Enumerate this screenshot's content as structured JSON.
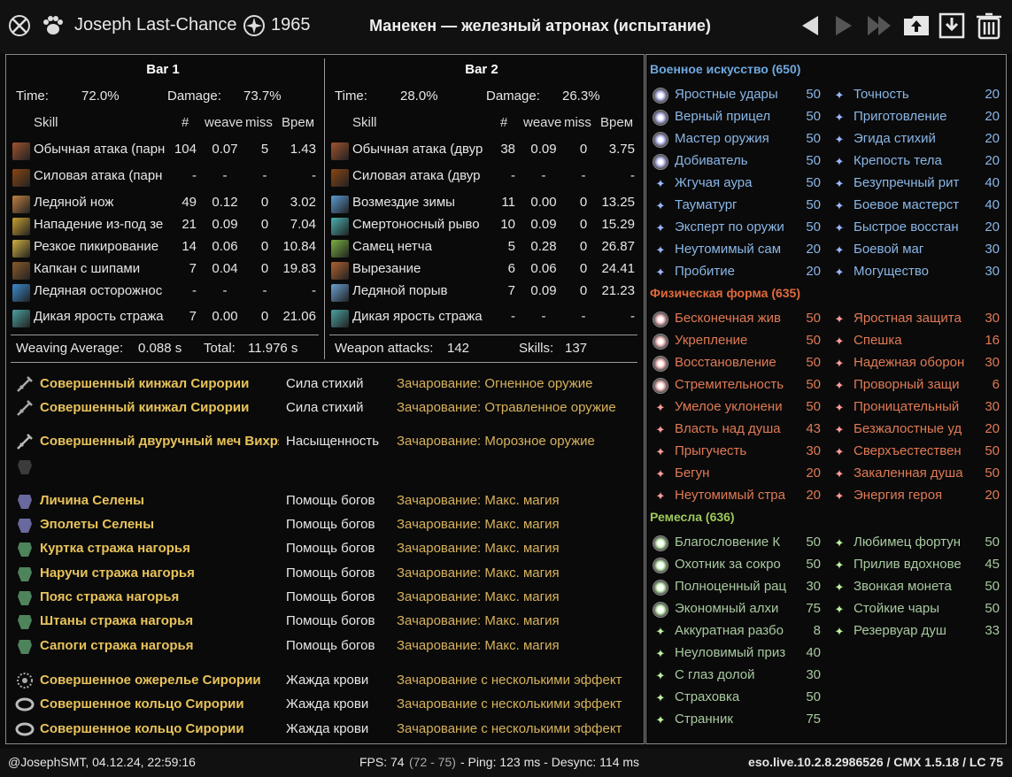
{
  "header": {
    "player": "Joseph Last-Chance",
    "cp": "1965",
    "title": "Манекен — железный атронах (испытание)"
  },
  "bar1": {
    "title": "Bar 1",
    "time_label": "Time:",
    "time": "72.0%",
    "damage_label": "Damage:",
    "damage": "73.7%",
    "cols": {
      "skill": "Skill",
      "count": "#",
      "weave": "weave",
      "miss": "miss",
      "time": "Врем"
    },
    "rows": [
      {
        "name": "Обычная атака (парн",
        "count": "104",
        "weave": "0.07",
        "miss": "5",
        "time": "1.43"
      },
      {
        "name": "Силовая атака (парн",
        "count": "-",
        "weave": "-",
        "miss": "-",
        "time": "-"
      },
      {
        "name": "Ледяной нож",
        "count": "49",
        "weave": "0.12",
        "miss": "0",
        "time": "3.02"
      },
      {
        "name": "Нападение из-под зе",
        "count": "21",
        "weave": "0.09",
        "miss": "0",
        "time": "7.04"
      },
      {
        "name": "Резкое пикирование",
        "count": "14",
        "weave": "0.06",
        "miss": "0",
        "time": "10.84"
      },
      {
        "name": "Капкан с шипами",
        "count": "7",
        "weave": "0.04",
        "miss": "0",
        "time": "19.83"
      },
      {
        "name": "Ледяная осторожнос",
        "count": "-",
        "weave": "-",
        "miss": "-",
        "time": "-"
      },
      {
        "name": "Дикая ярость стража",
        "count": "7",
        "weave": "0.00",
        "miss": "0",
        "time": "21.06"
      }
    ],
    "footer_label1": "Weaving Average:",
    "footer_val1": "0.088 s",
    "footer_label2": "Total:",
    "footer_val2": "11.976 s"
  },
  "bar2": {
    "title": "Bar 2",
    "time_label": "Time:",
    "time": "28.0%",
    "damage_label": "Damage:",
    "damage": "26.3%",
    "cols": {
      "skill": "Skill",
      "count": "#",
      "weave": "weave",
      "miss": "miss",
      "time": "Врем"
    },
    "rows": [
      {
        "name": "Обычная атака (двур",
        "count": "38",
        "weave": "0.09",
        "miss": "0",
        "time": "3.75"
      },
      {
        "name": "Силовая атака (двур",
        "count": "-",
        "weave": "-",
        "miss": "-",
        "time": "-"
      },
      {
        "name": "Возмездие зимы",
        "count": "11",
        "weave": "0.00",
        "miss": "0",
        "time": "13.25"
      },
      {
        "name": "Смертоносный рыво",
        "count": "10",
        "weave": "0.09",
        "miss": "0",
        "time": "15.29"
      },
      {
        "name": "Самец нетча",
        "count": "5",
        "weave": "0.28",
        "miss": "0",
        "time": "26.87"
      },
      {
        "name": "Вырезание",
        "count": "6",
        "weave": "0.06",
        "miss": "0",
        "time": "24.41"
      },
      {
        "name": "Ледяной порыв",
        "count": "7",
        "weave": "0.09",
        "miss": "0",
        "time": "21.23"
      },
      {
        "name": "Дикая ярость стража",
        "count": "-",
        "weave": "-",
        "miss": "-",
        "time": "-"
      }
    ],
    "footer_label1": "Weapon attacks:",
    "footer_val1": "142",
    "footer_label2": "Skills:",
    "footer_val2": "137"
  },
  "gear": [
    {
      "name": "Совершенный кинжал Сирории",
      "trait": "Сила стихий",
      "ench": "Зачарование: Огненное оружие",
      "icon": "dagger-icon"
    },
    {
      "name": "Совершенный кинжал Сирории",
      "trait": "Сила стихий",
      "ench": "Зачарование: Отравленное оружие",
      "icon": "dagger-icon"
    },
    {
      "name": "Совершенный двуручный меч Вихря",
      "trait": "Насыщенность",
      "ench": "Зачарование: Морозное оружие",
      "icon": "greatsword-icon"
    },
    {
      "name": "",
      "trait": "",
      "ench": "",
      "icon": "empty-slot-icon"
    },
    {
      "name": "Личина Селены",
      "trait": "Помощь богов",
      "ench": "Зачарование: Макс. магия",
      "icon": "helmet-icon"
    },
    {
      "name": "Эполеты Селены",
      "trait": "Помощь богов",
      "ench": "Зачарование: Макс. магия",
      "icon": "shoulders-icon"
    },
    {
      "name": "Куртка стража нагорья",
      "trait": "Помощь богов",
      "ench": "Зачарование: Макс. магия",
      "icon": "chest-icon"
    },
    {
      "name": "Наручи стража нагорья",
      "trait": "Помощь богов",
      "ench": "Зачарование: Макс. магия",
      "icon": "gloves-icon"
    },
    {
      "name": "Пояс стража нагорья",
      "trait": "Помощь богов",
      "ench": "Зачарование: Макс. магия",
      "icon": "belt-icon"
    },
    {
      "name": "Штаны стража нагорья",
      "trait": "Помощь богов",
      "ench": "Зачарование: Макс. магия",
      "icon": "pants-icon"
    },
    {
      "name": "Сапоги стража нагорья",
      "trait": "Помощь богов",
      "ench": "Зачарование: Макс. магия",
      "icon": "boots-icon"
    },
    {
      "name": "Совершенное ожерелье Сирории",
      "trait": "Жажда крови",
      "ench": "Зачарование с несколькими эффект",
      "icon": "necklace-icon"
    },
    {
      "name": "Совершенное кольцо Сирории",
      "trait": "Жажда крови",
      "ench": "Зачарование с несколькими эффект",
      "icon": "ring-icon"
    },
    {
      "name": "Совершенное кольцо Сирории",
      "trait": "Жажда крови",
      "ench": "Зачарование с несколькими эффект",
      "icon": "ring-icon"
    }
  ],
  "cp": {
    "warfare": {
      "title": "Военное искусство (650)",
      "left": [
        {
          "name": "Яростные удары",
          "val": "50",
          "slotted": true
        },
        {
          "name": "Верный прицел",
          "val": "50",
          "slotted": true
        },
        {
          "name": "Мастер оружия",
          "val": "50",
          "slotted": true
        },
        {
          "name": "Добиватель",
          "val": "50",
          "slotted": true
        },
        {
          "name": "Жгучая аура",
          "val": "50",
          "slotted": false
        },
        {
          "name": "Тауматург",
          "val": "50",
          "slotted": false
        },
        {
          "name": "Эксперт по оружи",
          "val": "50",
          "slotted": false
        },
        {
          "name": "Неутомимый сам",
          "val": "20",
          "slotted": false
        },
        {
          "name": "Пробитие",
          "val": "20",
          "slotted": false
        }
      ],
      "right": [
        {
          "name": "Точность",
          "val": "20"
        },
        {
          "name": "Приготовление",
          "val": "20"
        },
        {
          "name": "Эгида стихий",
          "val": "20"
        },
        {
          "name": "Крепость тела",
          "val": "20"
        },
        {
          "name": "Безупречный рит",
          "val": "40"
        },
        {
          "name": "Боевое мастерст",
          "val": "40"
        },
        {
          "name": "Быстрое восстан",
          "val": "20"
        },
        {
          "name": "Боевой маг",
          "val": "30"
        },
        {
          "name": "Могущество",
          "val": "30"
        }
      ]
    },
    "fitness": {
      "title": "Физическая форма (635)",
      "left": [
        {
          "name": "Бесконечная жив",
          "val": "50",
          "slotted": true
        },
        {
          "name": "Укрепление",
          "val": "50",
          "slotted": true
        },
        {
          "name": "Восстановление",
          "val": "50",
          "slotted": true
        },
        {
          "name": "Стремительность",
          "val": "50",
          "slotted": true
        },
        {
          "name": "Умелое уклонени",
          "val": "50",
          "slotted": false
        },
        {
          "name": "Власть над душа",
          "val": "43",
          "slotted": false
        },
        {
          "name": "Прыгучесть",
          "val": "30",
          "slotted": false
        },
        {
          "name": "Бегун",
          "val": "20",
          "slotted": false
        },
        {
          "name": "Неутомимый стра",
          "val": "20",
          "slotted": false
        }
      ],
      "right": [
        {
          "name": "Яростная защита",
          "val": "30"
        },
        {
          "name": "Спешка",
          "val": "16"
        },
        {
          "name": "Надежная оборон",
          "val": "30"
        },
        {
          "name": "Проворный защи",
          "val": "6"
        },
        {
          "name": "Проницательный",
          "val": "30"
        },
        {
          "name": "Безжалостные уд",
          "val": "20"
        },
        {
          "name": "Сверхъестествен",
          "val": "50"
        },
        {
          "name": "Закаленная душа",
          "val": "50"
        },
        {
          "name": "Энергия героя",
          "val": "20"
        }
      ]
    },
    "craft": {
      "title": "Ремесла (636)",
      "left": [
        {
          "name": "Благословение К",
          "val": "50",
          "slotted": true
        },
        {
          "name": "Охотник за сокро",
          "val": "50",
          "slotted": true
        },
        {
          "name": "Полноценный рац",
          "val": "30",
          "slotted": true
        },
        {
          "name": "Экономный алхи",
          "val": "75",
          "slotted": true
        },
        {
          "name": "Аккуратная разбо",
          "val": "8",
          "slotted": false
        },
        {
          "name": "Неуловимый приз",
          "val": "40",
          "slotted": false
        },
        {
          "name": "С глаз долой",
          "val": "30",
          "slotted": false
        },
        {
          "name": "Страховка",
          "val": "50",
          "slotted": false
        },
        {
          "name": "Странник",
          "val": "75",
          "slotted": false
        }
      ],
      "right": [
        {
          "name": "Любимец фортун",
          "val": "50"
        },
        {
          "name": "Прилив вдохнове",
          "val": "45"
        },
        {
          "name": "Звонкая монета",
          "val": "50"
        },
        {
          "name": "Стойкие чары",
          "val": "50"
        },
        {
          "name": "Резервуар душ",
          "val": "33"
        }
      ]
    }
  },
  "footer": {
    "left": "@JosephSMT, 04.12.24, 22:59:16",
    "fps_label": "FPS: 74",
    "fps_range": "(72 - 75)",
    "ping": "- Ping: 123 ms - Desync: 114 ms",
    "version": "eso.live.10.2.8.2986526 / CMX 1.5.18 / LC 75"
  },
  "colors": {
    "gold": "#e8c35a",
    "warfare": "#6fa8e0",
    "fitness": "#e06a3c",
    "craft": "#9ec95c"
  }
}
